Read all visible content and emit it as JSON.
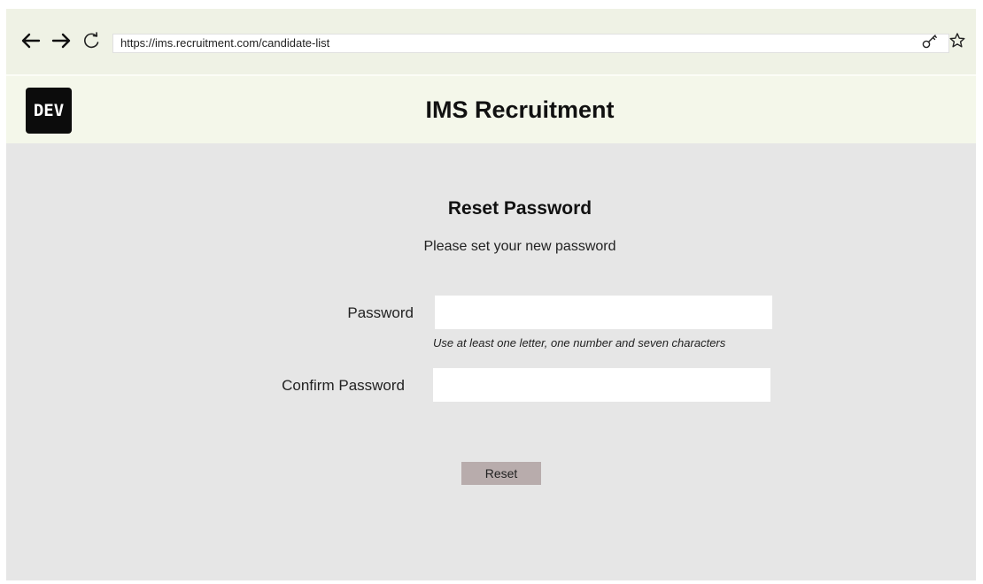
{
  "browser": {
    "url": "https://ims.recruitment.com/candidate-list",
    "icons": [
      "arrow-left-icon",
      "arrow-right-icon",
      "reload-icon",
      "key-icon",
      "star-icon"
    ]
  },
  "header": {
    "logo_text": "DEV",
    "title": "IMS Recruitment"
  },
  "form": {
    "title": "Reset Password",
    "subtitle": "Please set your new password",
    "password_label": "Password",
    "password_value": "",
    "password_hint": "Use at least one letter, one number and seven characters",
    "confirm_label": "Confirm Password",
    "confirm_value": "",
    "reset_label": "Reset"
  },
  "colors": {
    "browser_bar": "#eff2e5",
    "header_bg": "#f4f7ea",
    "content_bg": "#e6e6e6",
    "button_bg": "#b8acac",
    "logo_bg": "#0c0c0c"
  }
}
